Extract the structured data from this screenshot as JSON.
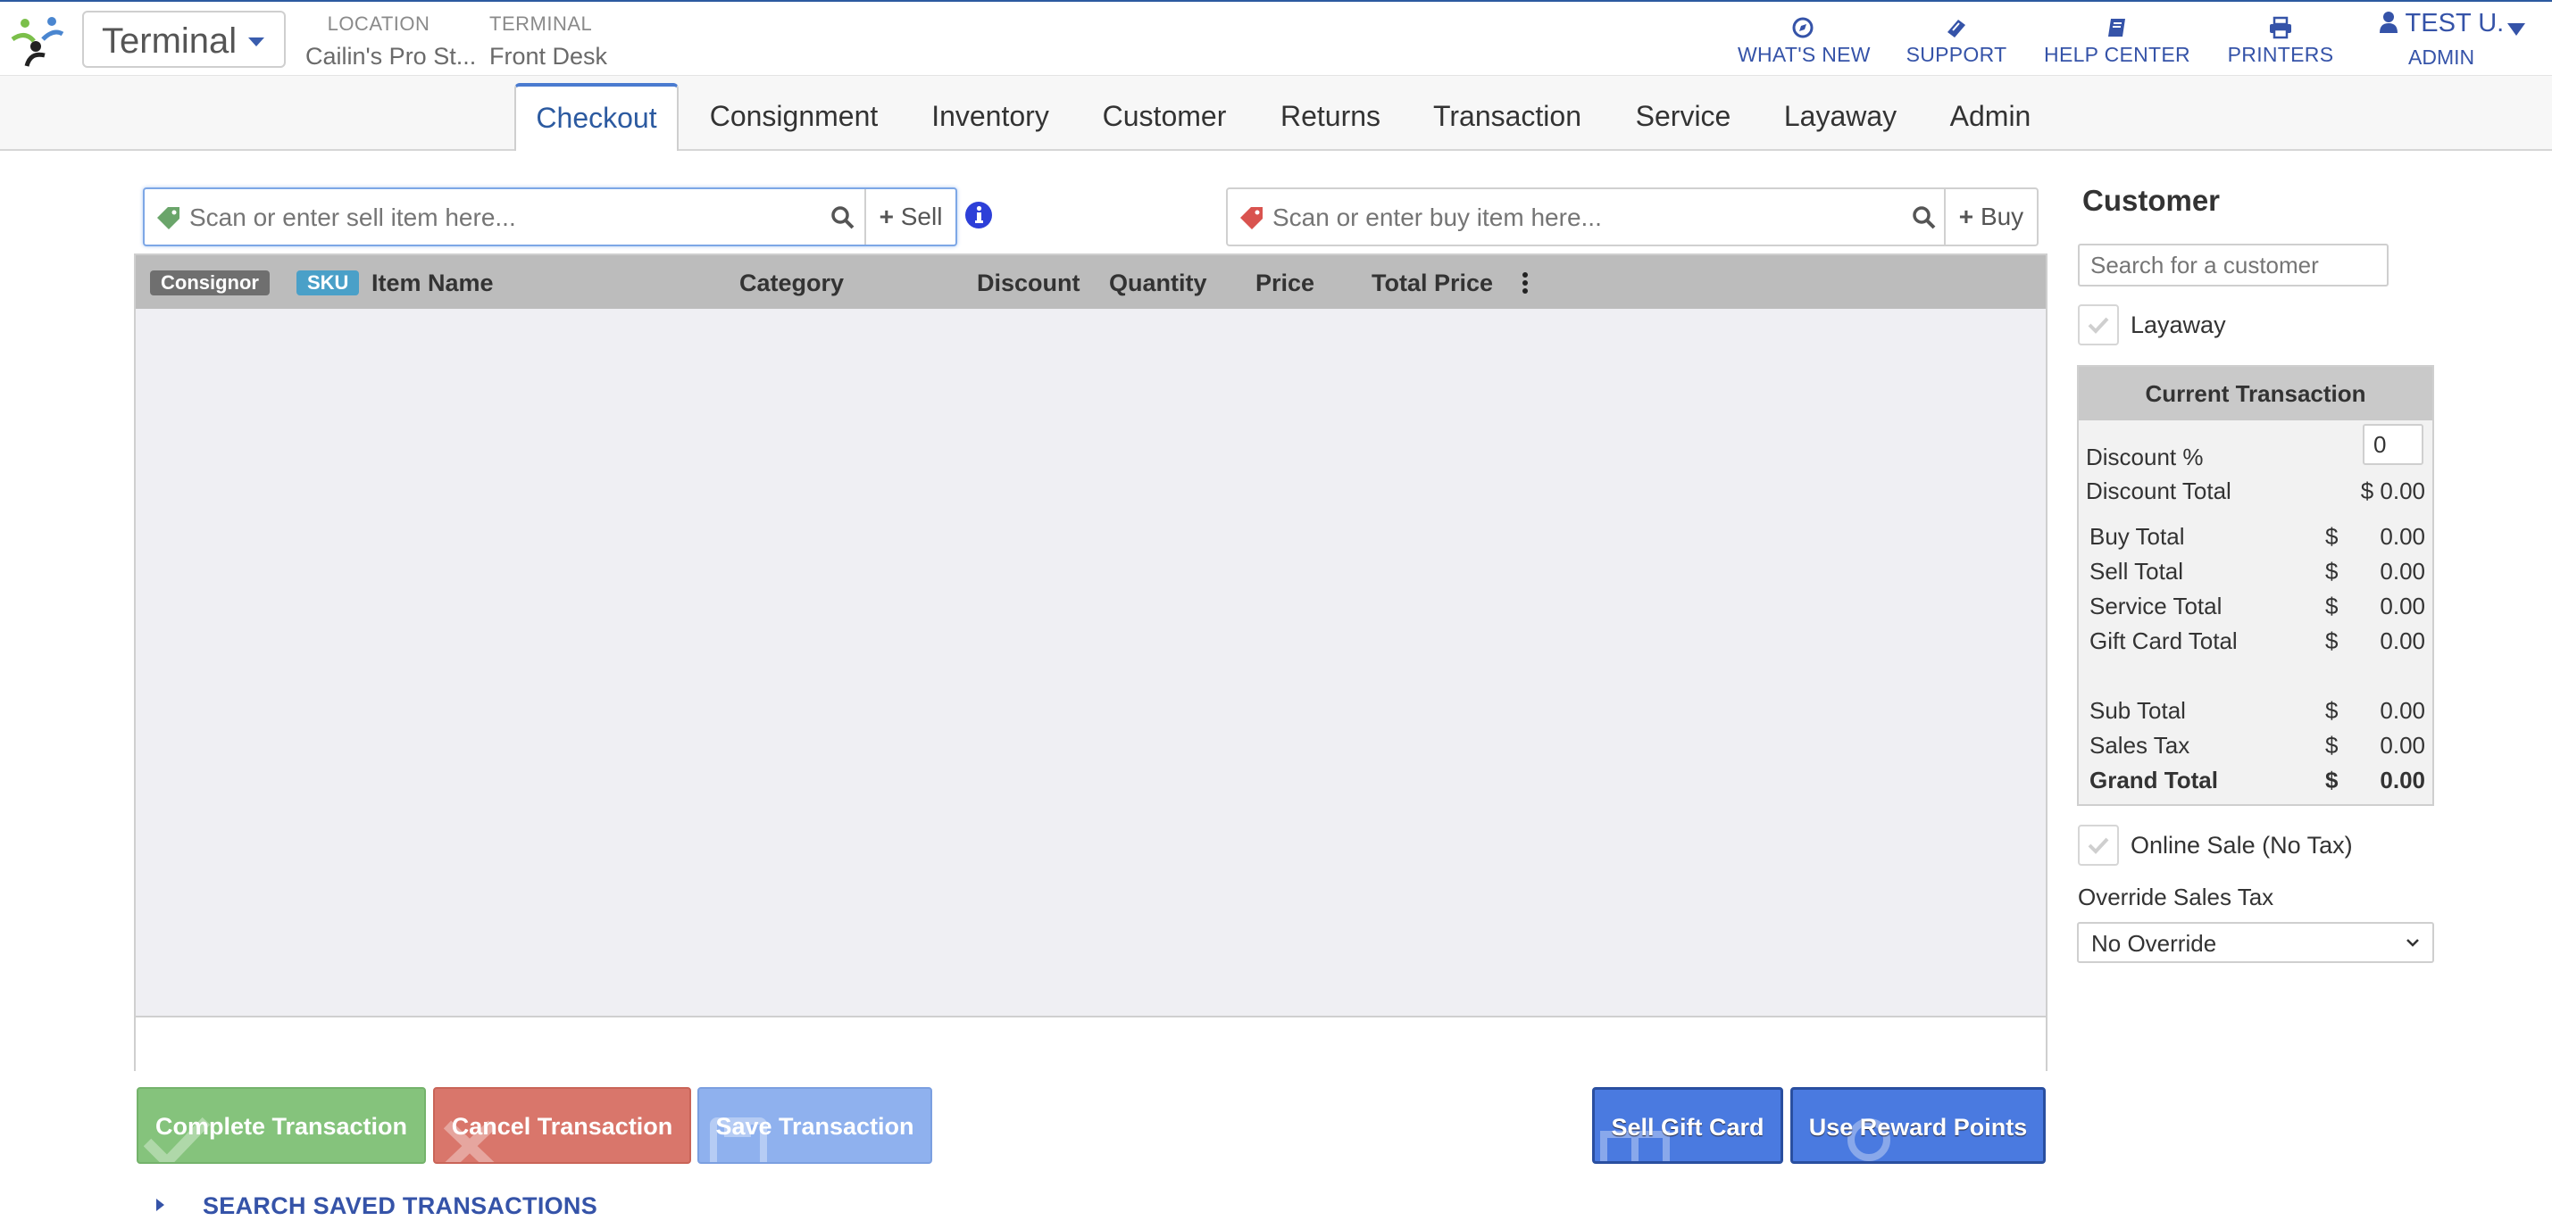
{
  "header": {
    "terminal_select": "Terminal",
    "location_label": "LOCATION",
    "location_value": "Cailin's Pro St...",
    "terminal_label": "TERMINAL",
    "terminal_value": "Front Desk",
    "links": [
      {
        "label": "WHAT'S NEW",
        "icon": "compass-icon"
      },
      {
        "label": "SUPPORT",
        "icon": "ticket-icon"
      },
      {
        "label": "HELP CENTER",
        "icon": "book-icon"
      },
      {
        "label": "PRINTERS",
        "icon": "printer-icon"
      }
    ],
    "user_name": "TEST U.",
    "user_role": "ADMIN"
  },
  "tabs": [
    {
      "label": "Checkout",
      "active": true
    },
    {
      "label": "Consignment"
    },
    {
      "label": "Inventory"
    },
    {
      "label": "Customer"
    },
    {
      "label": "Returns"
    },
    {
      "label": "Transaction"
    },
    {
      "label": "Service"
    },
    {
      "label": "Layaway"
    },
    {
      "label": "Admin"
    }
  ],
  "sell": {
    "placeholder": "Scan or enter sell item here...",
    "button": "Sell"
  },
  "buy": {
    "placeholder": "Scan or enter buy item here...",
    "button": "Buy"
  },
  "grid": {
    "badges": {
      "consignor": "Consignor",
      "sku": "SKU"
    },
    "columns": {
      "item_name": "Item Name",
      "category": "Category",
      "discount": "Discount",
      "quantity": "Quantity",
      "price": "Price",
      "total_price": "Total Price"
    },
    "rows": []
  },
  "actions": {
    "complete": "Complete Transaction",
    "cancel": "Cancel Transaction",
    "save": "Save Transaction",
    "gift_card": "Sell Gift Card",
    "reward": "Use Reward Points",
    "saved_link": "SEARCH SAVED TRANSACTIONS"
  },
  "customer": {
    "title": "Customer",
    "search_placeholder": "Search for a customer",
    "layaway_label": "Layaway"
  },
  "current_transaction": {
    "title": "Current Transaction",
    "discount_pct_label": "Discount %",
    "discount_pct_value": "0",
    "discount_total_label": "Discount Total",
    "discount_total_value": "$ 0.00",
    "currency": "$",
    "rows": [
      {
        "label": "Buy Total",
        "value": "0.00"
      },
      {
        "label": "Sell Total",
        "value": "0.00"
      },
      {
        "label": "Service Total",
        "value": "0.00"
      },
      {
        "label": "Gift Card Total",
        "value": "0.00"
      },
      {
        "label": "Sub Total",
        "value": "0.00"
      },
      {
        "label": "Sales Tax",
        "value": "0.00"
      },
      {
        "label": "Grand Total",
        "value": "0.00"
      }
    ]
  },
  "online_sale_label": "Online Sale (No Tax)",
  "override": {
    "label": "Override Sales Tax",
    "selected": "No Override"
  },
  "colors": {
    "brand_blue": "#3553a8",
    "active_tab": "#2c5aa0",
    "complete": "#85c37c",
    "cancel": "#d9766b",
    "save": "#8fb1ee",
    "gift": "#4a7ae0"
  }
}
